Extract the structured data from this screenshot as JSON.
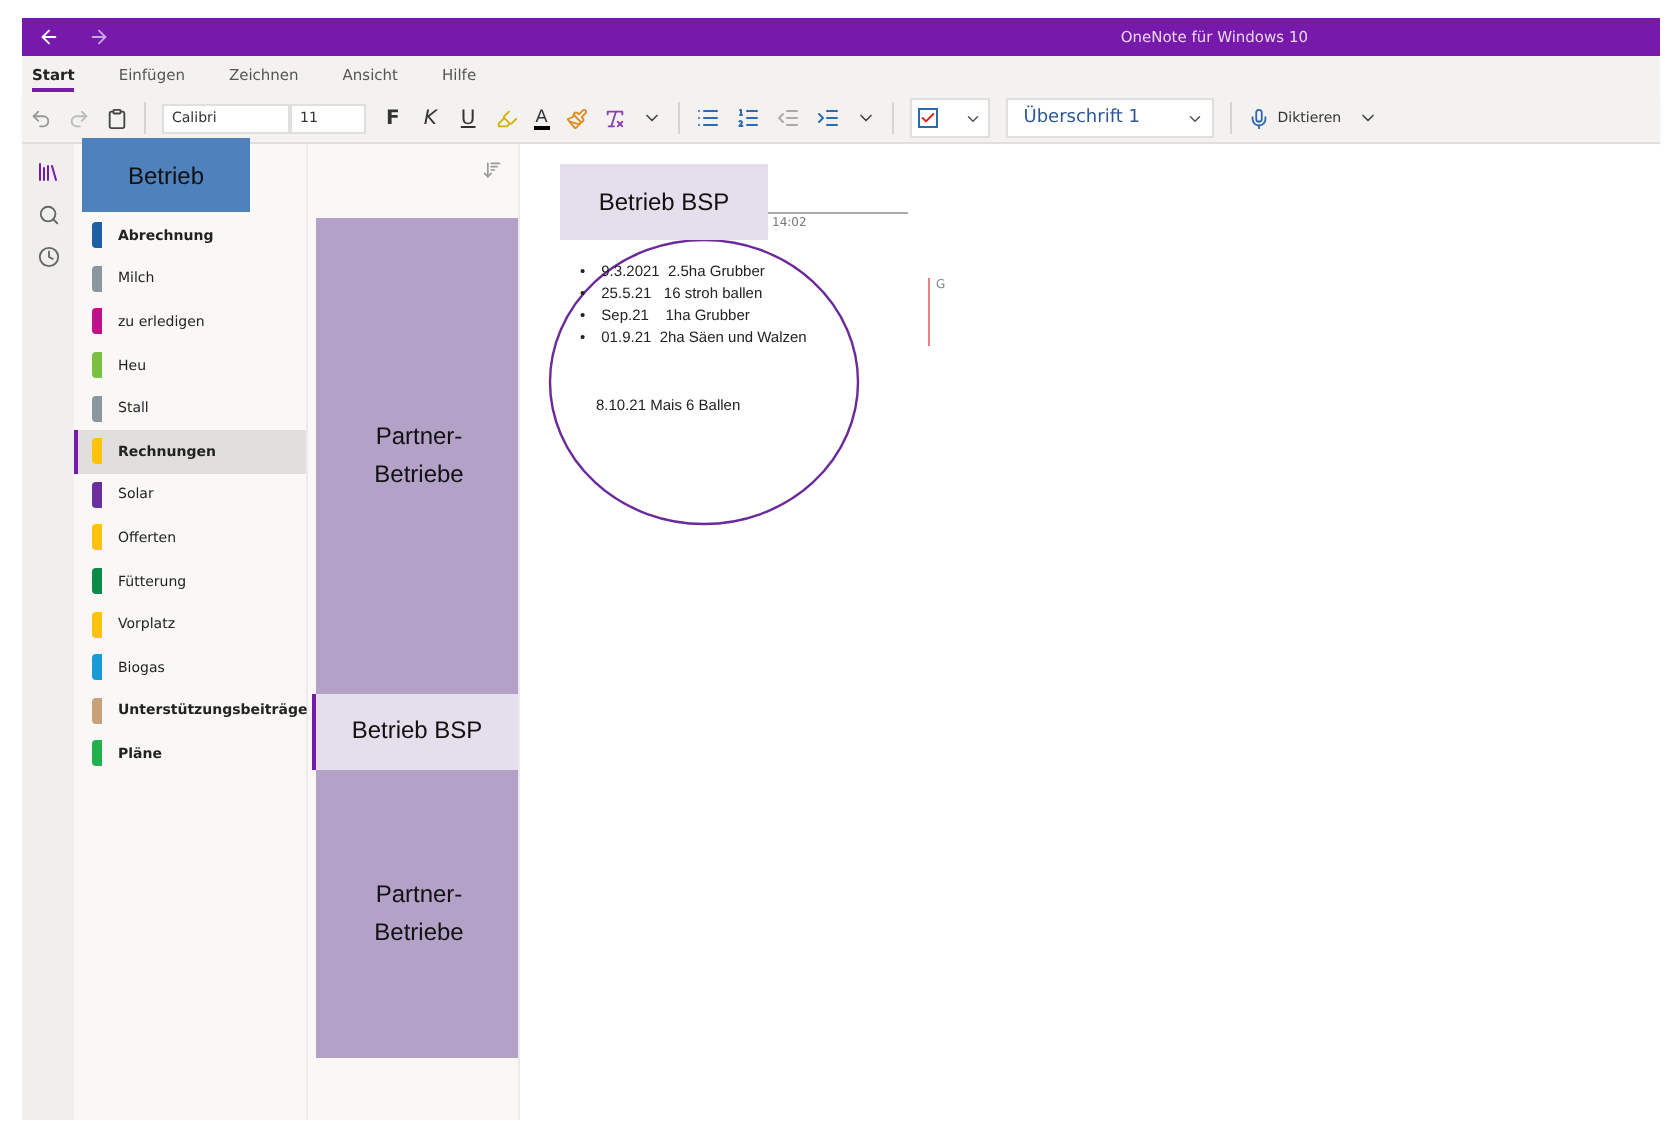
{
  "window": {
    "title": "OneNote für Windows 10"
  },
  "tabs": [
    {
      "label": "Start",
      "selected": true
    },
    {
      "label": "Einfügen",
      "selected": false
    },
    {
      "label": "Zeichnen",
      "selected": false
    },
    {
      "label": "Ansicht",
      "selected": false
    },
    {
      "label": "Hilfe",
      "selected": false
    }
  ],
  "toolbar": {
    "font": "Calibri",
    "size": "11",
    "bold": "F",
    "italic": "K",
    "underline": "U",
    "font_color": "A",
    "style": "Überschrift 1",
    "dictate": "Diktieren",
    "tag_checked": true
  },
  "notebook": {
    "label": "Betrieb"
  },
  "sections": [
    {
      "label": "Abrechnung",
      "color": "#1f5fa8",
      "selected": false
    },
    {
      "label": "Milch",
      "color": "#8a96a0",
      "selected": false
    },
    {
      "label": "zu erledigen",
      "color": "#c0108c",
      "selected": false
    },
    {
      "label": "Heu",
      "color": "#7ac142",
      "selected": false
    },
    {
      "label": "Stall",
      "color": "#8a96a0",
      "selected": false
    },
    {
      "label": "Rechnungen",
      "color": "#ffc20e",
      "selected": true
    },
    {
      "label": "Solar",
      "color": "#6b2fa0",
      "selected": false
    },
    {
      "label": "Offerten",
      "color": "#ffc20e",
      "selected": false
    },
    {
      "label": "Fütterung",
      "color": "#0b8a4a",
      "selected": false
    },
    {
      "label": "Vorplatz",
      "color": "#ffc20e",
      "selected": false
    },
    {
      "label": "Biogas",
      "color": "#1a9bd7",
      "selected": false
    },
    {
      "label": "Unterstützungsbeiträge",
      "color": "#c8a07a",
      "selected": false
    },
    {
      "label": "Pläne",
      "color": "#22b14c",
      "selected": false
    }
  ],
  "pages": [
    {
      "label": "Partner-Betriebe",
      "selected": false
    },
    {
      "label": "Betrieb BSP",
      "selected": true
    },
    {
      "label": "Partner-Betriebe",
      "selected": false
    }
  ],
  "page": {
    "title": "Betrieb BSP",
    "time": "14:02",
    "bullet_marker": "•",
    "bullets": [
      "9.3.2021  2.5ha Grubber",
      "25.5.21   16 stroh ballen",
      "Sep.21    1ha Grubber",
      "01.9.21  2ha Säen und Walzen"
    ],
    "note": "8.10.21 Mais 6 Ballen",
    "side_mark": "G"
  }
}
